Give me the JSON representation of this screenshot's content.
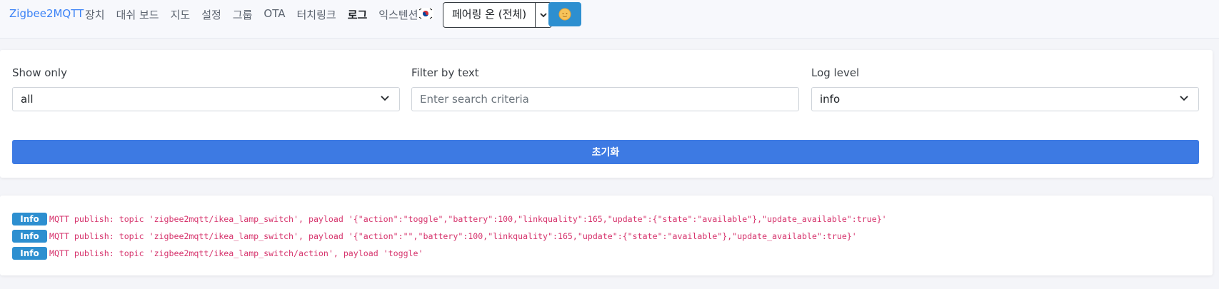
{
  "navbar": {
    "brand": "Zigbee2MQTT",
    "links": [
      "장치",
      "대쉬 보드",
      "지도",
      "설정",
      "그룹",
      "OTA",
      "터치링크",
      "로그",
      "익스텐션"
    ],
    "active_link": "로그",
    "language_flag": "korea-flag-icon",
    "permit_join_label": "페어링 온 (전체)",
    "theme_icon": "sun-moon-icon",
    "theme_button_color": "#2d8fd0"
  },
  "filters": {
    "show_only": {
      "label": "Show only",
      "value": "all"
    },
    "filter_text": {
      "label": "Filter by text",
      "placeholder": "Enter search criteria"
    },
    "log_level": {
      "label": "Log level",
      "value": "info"
    },
    "reset_label": "초기화",
    "reset_color": "#3d7ae3"
  },
  "logs": [
    {
      "level": "Info",
      "message": "MQTT publish: topic 'zigbee2mqtt/ikea_lamp_switch', payload '{\"action\":\"toggle\",\"battery\":100,\"linkquality\":165,\"update\":{\"state\":\"available\"},\"update_available\":true}'"
    },
    {
      "level": "Info",
      "message": "MQTT publish: topic 'zigbee2mqtt/ikea_lamp_switch', payload '{\"action\":\"\",\"battery\":100,\"linkquality\":165,\"update\":{\"state\":\"available\"},\"update_available\":true}'"
    },
    {
      "level": "Info",
      "message": "MQTT publish: topic 'zigbee2mqtt/ikea_lamp_switch/action', payload 'toggle'"
    }
  ]
}
